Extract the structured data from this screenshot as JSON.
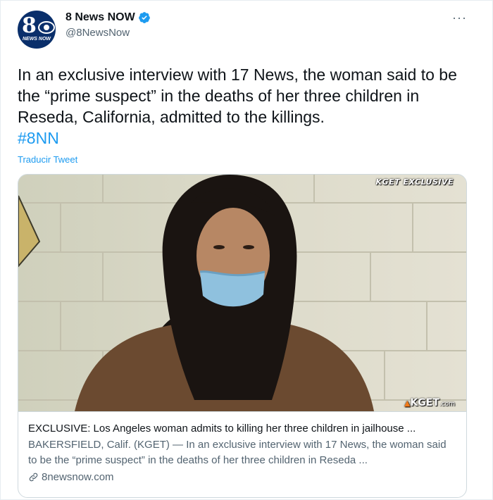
{
  "author": {
    "display_name": "8 News NOW",
    "handle": "@8NewsNow",
    "avatar_logo_text": "NEWS NOW",
    "avatar_logo_num": "8",
    "verified": true
  },
  "more_label": "···",
  "tweet": {
    "text": "In an exclusive interview with 17 News, the woman said to be the “prime suspect” in the deaths of her three children in Reseda, California, admitted to the killings.",
    "hashtag": "#8NN",
    "translate_label": "Traducir Tweet"
  },
  "card": {
    "image_overlay_tag": "KGET EXCLUSIVE",
    "image_logo": "KGET",
    "image_logo_suffix": ".com",
    "title": "EXCLUSIVE: Los Angeles woman admits to killing her three children in jailhouse ...",
    "description": "BAKERSFIELD, Calif. (KGET) — In an exclusive interview with 17 News, the woman said to be the “prime suspect” in the deaths of her three children in Reseda ...",
    "domain": "8newsnow.com"
  },
  "colors": {
    "accent": "#1d9bf0",
    "text_primary": "#0f1419",
    "text_secondary": "#536471",
    "border": "#cfd9de"
  }
}
